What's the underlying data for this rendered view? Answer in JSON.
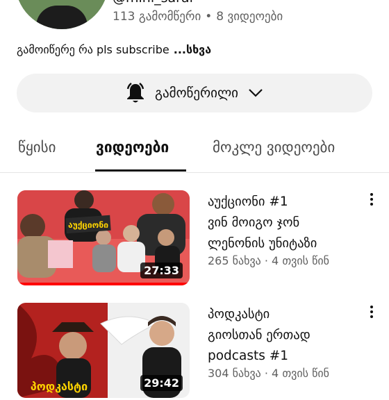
{
  "channel": {
    "handle": "@mini_sarai",
    "subscribers": "113 გამომწერი",
    "separator": "•",
    "videos_count": "8 ვიდეოები",
    "description": "გამოიწერე რა pls subscribe",
    "more_label": "...სხვა"
  },
  "subscribe_button": {
    "label": "გამოწერილი",
    "icon": "bell-icon",
    "chevron": "chevron-down-icon"
  },
  "tabs": [
    {
      "label": "წყისი",
      "active": false
    },
    {
      "label": "ვიდეოები",
      "active": true
    },
    {
      "label": "მოკლე ვიდეოები",
      "active": false
    }
  ],
  "videos": [
    {
      "title": "აუქციონი #1\nვინ მოიგო ჯონ\nლენონის უნიტაზი",
      "meta": "265 ნახვა · 4 თვის წინ",
      "duration": "27:33",
      "watched_fraction": 1.0,
      "thumb_caption": "აუქციონი"
    },
    {
      "title": "პოდკასტი\nგიოსთან ერთად\npodcasts #1",
      "meta": "304 ნახვა · 4 თვის წინ",
      "duration": "29:42",
      "watched_fraction": 0.0,
      "thumb_caption": "პოდკასტი"
    }
  ],
  "colors": {
    "progress": "#ff0000",
    "button_bg": "#f2f2f2",
    "meta_text": "#606060"
  }
}
